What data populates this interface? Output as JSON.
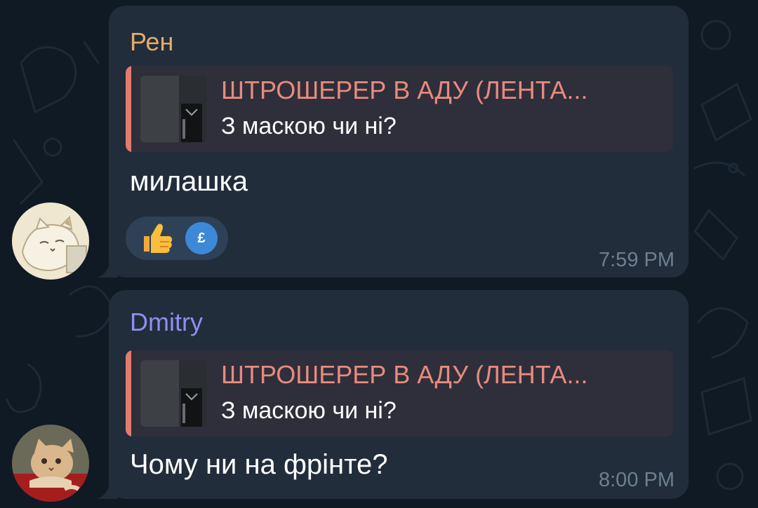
{
  "colors": {
    "background": "#0f1a24",
    "bubble": "#212d3b",
    "reply_bar": "#e37b6f",
    "reply_title": "#ea8a7d",
    "sender_ren": "#e3ab69",
    "sender_dmitry": "#8f8ef0",
    "time": "#6d7f91"
  },
  "messages": [
    {
      "sender": "Рен",
      "sender_color": "#e3ab69",
      "reply_title": "ШТРОШЕРЕР В АДУ (ЛЕНТА...",
      "reply_text": "З маскою чи ні?",
      "text": "милашка",
      "reactions": {
        "emoji_icon": "thumbs-up-icon",
        "user_avatar_text": "£"
      },
      "time": "7:59 PM",
      "avatar": "cat-drawing-avatar"
    },
    {
      "sender": "Dmitry",
      "sender_color": "#8f8ef0",
      "reply_title": "ШТРОШЕРЕР В АДУ (ЛЕНТА...",
      "reply_text": "З маскою чи ні?",
      "text": "Чому ни на фрінте?",
      "time": "8:00 PM",
      "avatar": "kitten-painting-avatar"
    }
  ]
}
